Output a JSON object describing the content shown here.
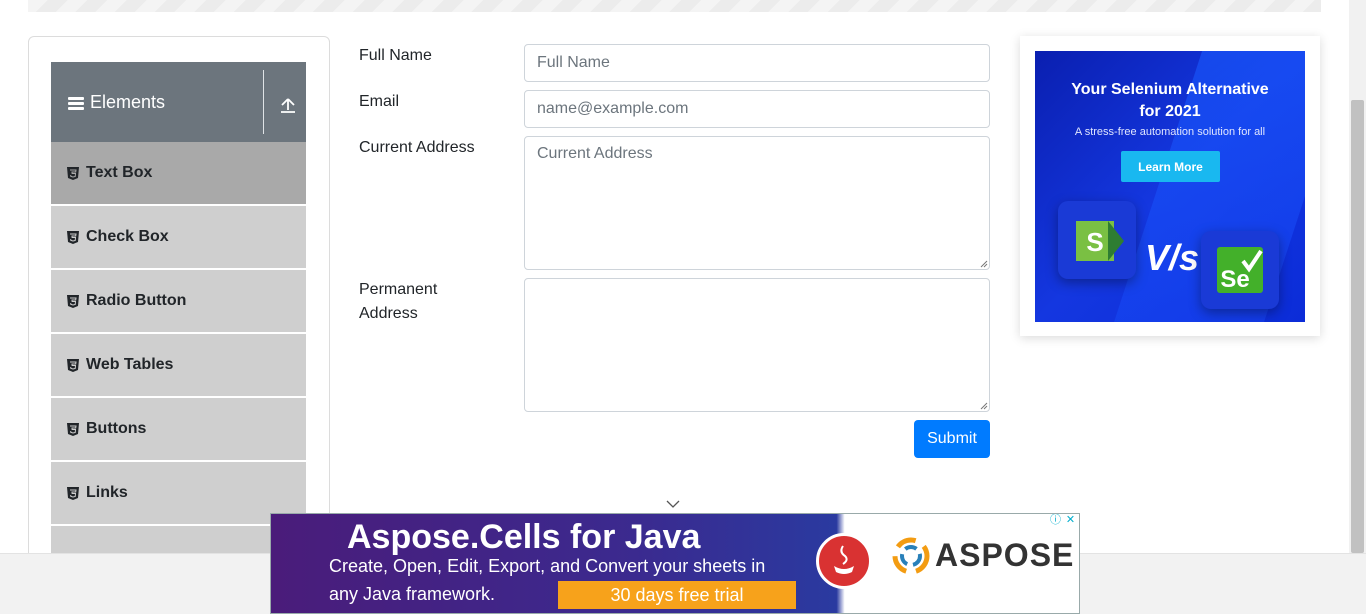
{
  "sidebar": {
    "group_title": "Elements",
    "items": [
      {
        "label": "Text Box",
        "active": true
      },
      {
        "label": "Check Box",
        "active": false
      },
      {
        "label": "Radio Button",
        "active": false
      },
      {
        "label": "Web Tables",
        "active": false
      },
      {
        "label": "Buttons",
        "active": false
      },
      {
        "label": "Links",
        "active": false
      }
    ]
  },
  "form": {
    "full_name": {
      "label": "Full Name",
      "placeholder": "Full Name",
      "value": ""
    },
    "email": {
      "label": "Email",
      "placeholder": "name@example.com",
      "value": ""
    },
    "current_address": {
      "label": "Current Address",
      "placeholder": "Current Address",
      "value": ""
    },
    "permanent_address": {
      "label_line1": "Permanent",
      "label_line2": "Address",
      "placeholder": "",
      "value": ""
    },
    "submit_label": "Submit"
  },
  "ad_right": {
    "headline_line1": "Your Selenium Alternative",
    "headline_line2": "for 2021",
    "subtext": "A stress-free automation solution for all",
    "cta": "Learn More",
    "vs_text": "V/s"
  },
  "ad_bottom": {
    "title": "Aspose.Cells for Java",
    "line1": "Create, Open, Edit, Export, and Convert your sheets in",
    "line2": "any Java framework.",
    "trial": "30 days free trial",
    "brand": "ASPOSE"
  },
  "colors": {
    "accent": "#007bff",
    "sidebar_header": "#6c757d",
    "menu_item": "#cfcfcf",
    "menu_item_active": "#a9a9a9"
  }
}
